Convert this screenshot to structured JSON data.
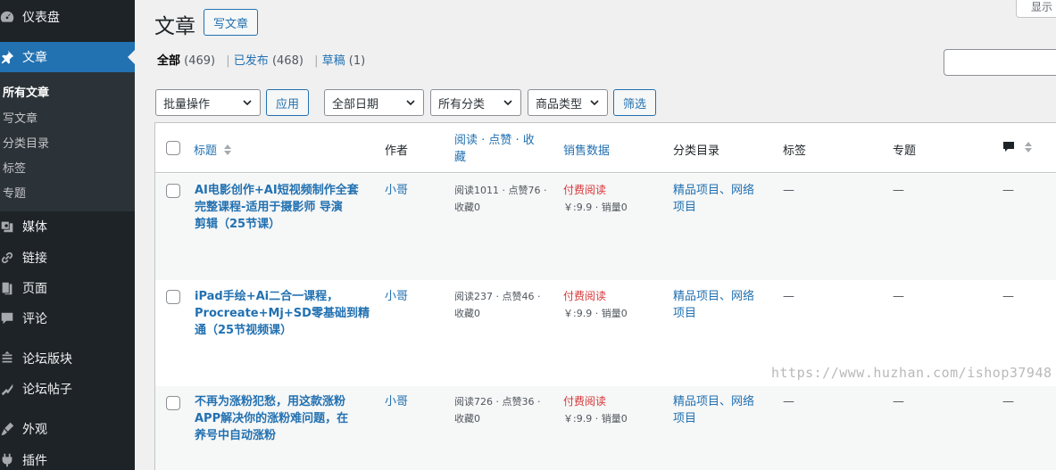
{
  "sidebar": {
    "items": [
      {
        "label": "仪表盘",
        "icon": "dashboard-icon"
      },
      {
        "label": "文章",
        "icon": "pin-icon"
      },
      {
        "label": "媒体",
        "icon": "media-icon"
      },
      {
        "label": "链接",
        "icon": "link-icon"
      },
      {
        "label": "页面",
        "icon": "page-icon"
      },
      {
        "label": "评论",
        "icon": "comment-icon"
      },
      {
        "label": "论坛版块",
        "icon": "forum-icon"
      },
      {
        "label": "论坛帖子",
        "icon": "topic-icon"
      },
      {
        "label": "外观",
        "icon": "appearance-icon"
      },
      {
        "label": "插件",
        "icon": "plugin-icon"
      }
    ],
    "submenu": [
      "所有文章",
      "写文章",
      "分类目录",
      "标签",
      "专题"
    ]
  },
  "header": {
    "title": "文章",
    "add_new": "写文章",
    "screen_options": "显示"
  },
  "filters": {
    "all": "全部",
    "all_count": "(469)",
    "published": "已发布",
    "published_count": "(468)",
    "draft": "草稿",
    "draft_count": "(1)",
    "sep": "|"
  },
  "toolbar": {
    "bulk": "批量操作",
    "apply": "应用",
    "date": "全部日期",
    "category": "所有分类",
    "product_type": "商品类型",
    "filter": "筛选"
  },
  "table": {
    "headers": {
      "title": "标题",
      "author": "作者",
      "stats_line1": "阅读 · 点赞 · 收",
      "stats_line2": "藏",
      "sales": "销售数据",
      "category": "分类目录",
      "tags": "标签",
      "topic": "专题"
    },
    "rows": [
      {
        "title": [
          "AI电影创作+AI短视频制作全套",
          "完整课程-适用于摄影师 导演",
          "剪辑（25节课）"
        ],
        "author": "小哥",
        "stats1": "阅读1011 · 点赞76 ·",
        "stats2": "收藏0",
        "sale1": "付费阅读",
        "sale2": "￥:9.9 · 销量0",
        "cat1": "精品项目、网络",
        "cat2": "项目",
        "tags": "—",
        "topic": "—",
        "comments": "—"
      },
      {
        "title": [
          "iPad手绘+Ai二合一课程，",
          "Procreate+Mj+SD零基础到精",
          "通（25节视频课）"
        ],
        "author": "小哥",
        "stats1": "阅读237 · 点赞46 ·",
        "stats2": "收藏0",
        "sale1": "付费阅读",
        "sale2": "￥:9.9 · 销量0",
        "cat1": "精品项目、网络",
        "cat2": "项目",
        "tags": "—",
        "topic": "—",
        "comments": "—"
      },
      {
        "title": [
          "不再为涨粉犯愁，用这款涨粉",
          "APP解决你的涨粉难问题，在",
          "养号中自动涨粉"
        ],
        "author": "小哥",
        "stats1": "阅读726 · 点赞36 ·",
        "stats2": "收藏0",
        "sale1": "付费阅读",
        "sale2": "￥:9.9 · 销量0",
        "cat1": "精品项目、网络",
        "cat2": "项目",
        "tags": "—",
        "topic": "—",
        "comments": "—"
      }
    ]
  },
  "watermark": "https://www.huzhan.com/ishop37948"
}
